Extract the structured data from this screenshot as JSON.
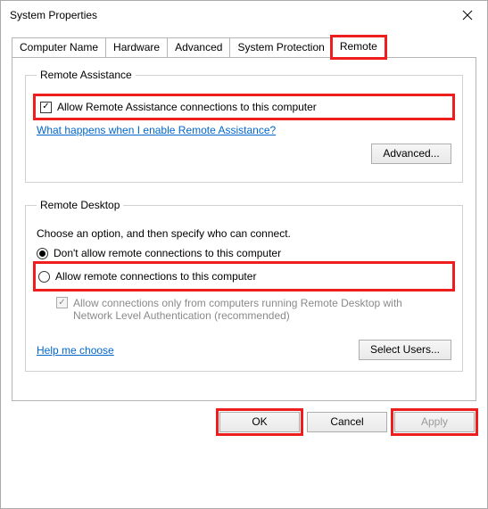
{
  "window": {
    "title": "System Properties"
  },
  "tabs": {
    "t0": "Computer Name",
    "t1": "Hardware",
    "t2": "Advanced",
    "t3": "System Protection",
    "t4": "Remote"
  },
  "remote_assistance": {
    "group_label": "Remote Assistance",
    "allow_label": "Allow Remote Assistance connections to this computer",
    "allow_checked": true,
    "help_link": "What happens when I enable Remote Assistance?",
    "advanced_button": "Advanced..."
  },
  "remote_desktop": {
    "group_label": "Remote Desktop",
    "intro": "Choose an option, and then specify who can connect.",
    "radio_deny": "Don't allow remote connections to this computer",
    "radio_allow": "Allow remote connections to this computer",
    "selected": "deny",
    "nla_label": "Allow connections only from computers running Remote Desktop with Network Level Authentication (recommended)",
    "nla_checked": true,
    "help_link": "Help me choose",
    "select_users_button": "Select Users..."
  },
  "footer": {
    "ok": "OK",
    "cancel": "Cancel",
    "apply": "Apply"
  }
}
